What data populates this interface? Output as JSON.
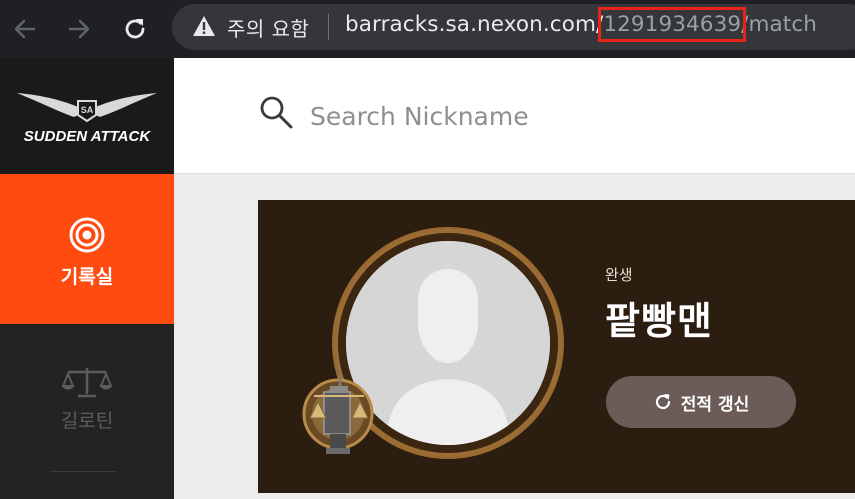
{
  "browser": {
    "security_warning": "주의 요함",
    "url_host": "barracks.sa.nexon.com/",
    "url_id": "1291934639",
    "url_path": "/match"
  },
  "sidebar": {
    "logo_text": "SUDDEN ATTACK",
    "items": [
      {
        "label": "기록실",
        "icon": "target-icon",
        "active": true
      },
      {
        "label": "길로틴",
        "icon": "scales-icon",
        "active": false
      }
    ]
  },
  "search": {
    "placeholder": "Search Nickname",
    "value": ""
  },
  "profile": {
    "rank_name": "완생",
    "nickname": "팥빵맨",
    "refresh_label": "전적 갱신"
  },
  "colors": {
    "accent": "#ff4a10",
    "card_bg": "#2b1d10",
    "highlight_box": "#e8231c"
  }
}
